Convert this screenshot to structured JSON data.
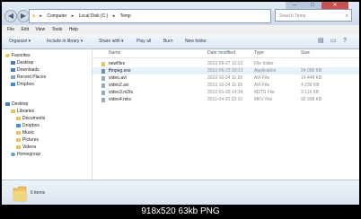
{
  "address": {
    "path": [
      "Computer",
      "Local Disk (C:)",
      "Temp"
    ],
    "arrow": "▸"
  },
  "search": {
    "placeholder": "Search Temp"
  },
  "window_controls": [
    "–",
    "□",
    "✕"
  ],
  "menu": [
    "File",
    "Edit",
    "View",
    "Tools",
    "Help"
  ],
  "toolbar": {
    "organize": "Organize ▾",
    "include": "Include in library ▾",
    "share": "Share with ▾",
    "play": "Play all",
    "burn": "Burn",
    "new_folder": "New folder"
  },
  "nav": {
    "favorites": [
      "Favorites",
      "Desktop",
      "Downloads",
      "Recent Places",
      "Dropbox"
    ],
    "tree": [
      "Desktop",
      "Libraries",
      "Documents",
      "Dropbox",
      "Music",
      "Pictures",
      "Videos",
      "Homegroup"
    ]
  },
  "columns": {
    "name": "Name",
    "date": "Date modified",
    "type": "Type",
    "size": "Size"
  },
  "files": [
    {
      "name": "newfiles",
      "date": "2012-05-27 12:22",
      "type": "File folder",
      "size": ""
    },
    {
      "name": "ffmpeg.exe",
      "date": "2012-05-23 20:21",
      "type": "Application",
      "size": "24 096 KB"
    },
    {
      "name": "video.avi",
      "date": "2012-10-24 11:26",
      "type": "AVI File",
      "size": "14 448 KB"
    },
    {
      "name": "video2.avi",
      "date": "2012-10-24 11:26",
      "type": "AVI File",
      "size": "4 239 KB"
    },
    {
      "name": "video3.m2ts",
      "date": "2012-01-03 14:34",
      "type": "M2TS File",
      "size": "3 119 KB"
    },
    {
      "name": "video4.mkv",
      "date": "2011-04-20 22:10",
      "type": "MKV File",
      "size": "92 938 KB"
    }
  ],
  "status": {
    "count": "6 items"
  },
  "caption": "918x520 63kb PNG",
  "colors": {
    "folder": "#e8c25a",
    "selection": "#e6f1fb",
    "frame": "#000000"
  }
}
